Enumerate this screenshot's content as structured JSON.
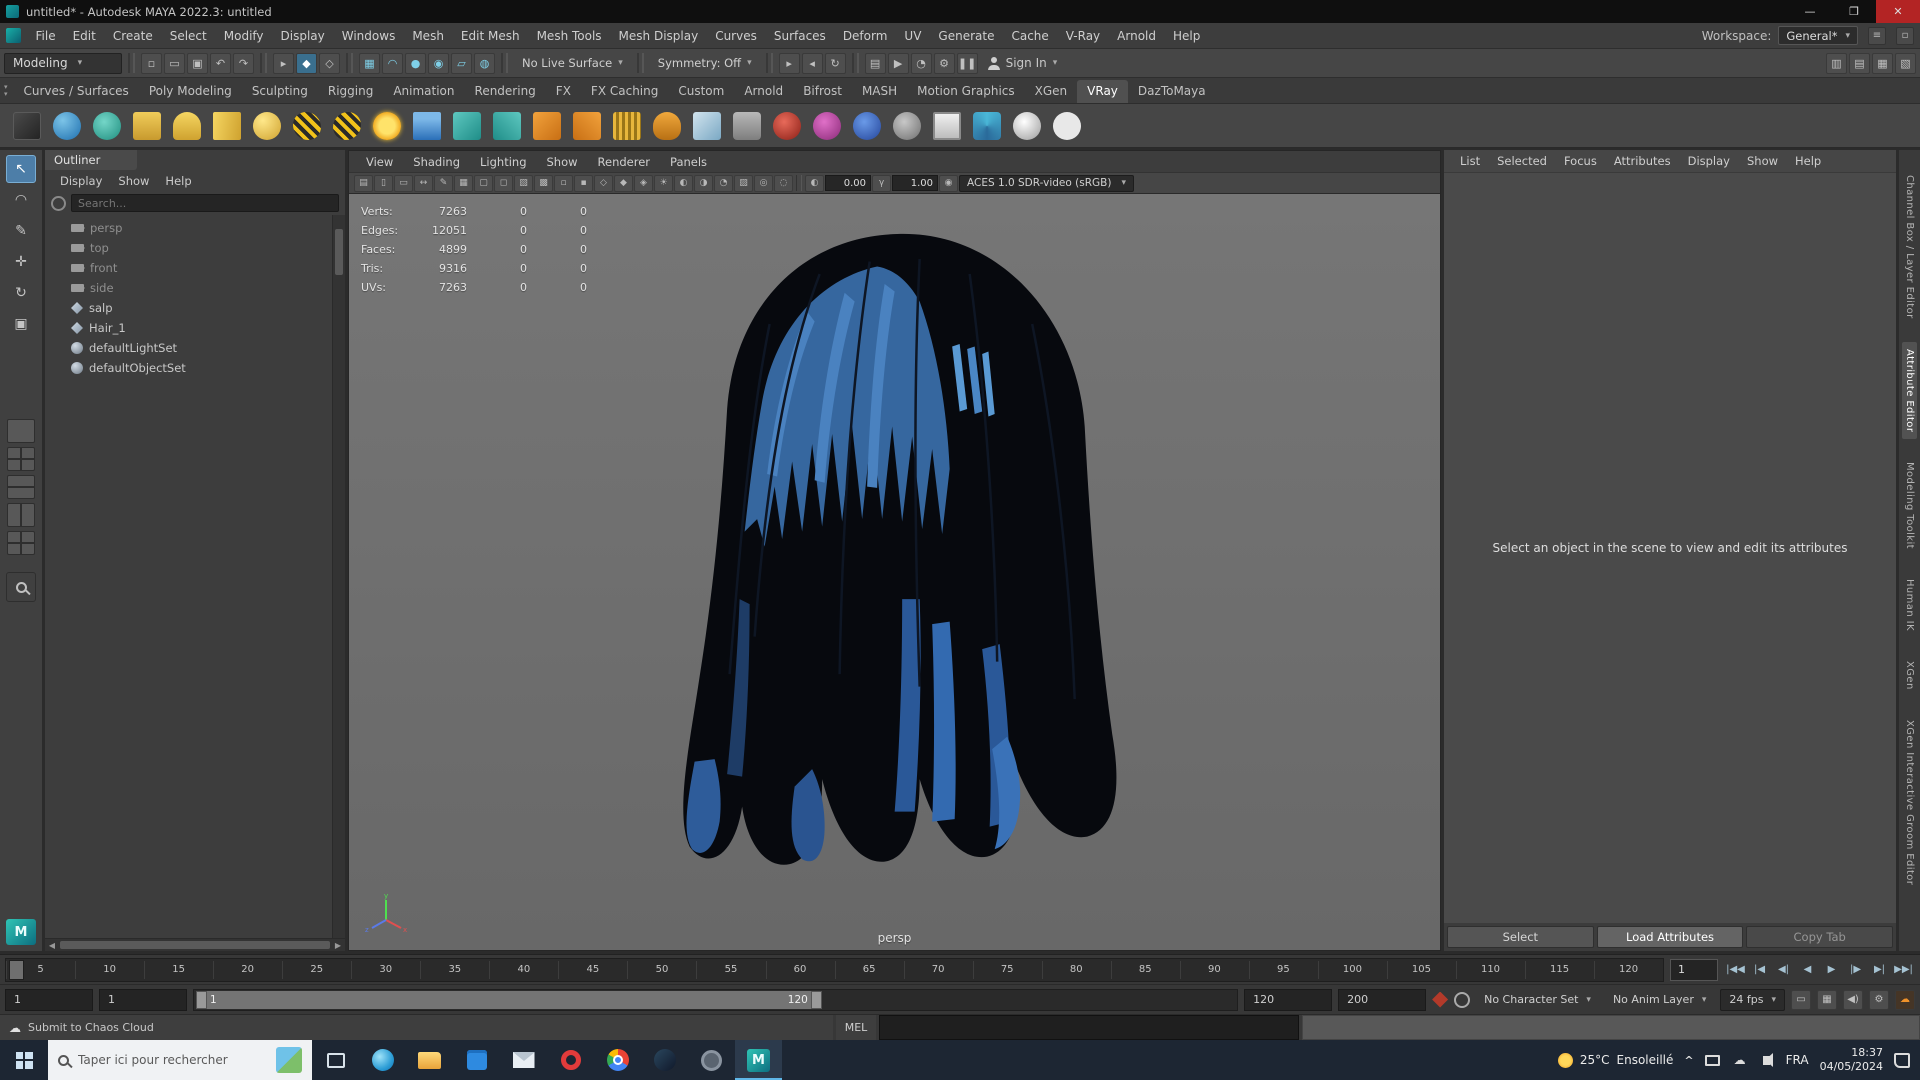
{
  "titlebar": {
    "title": "untitled* - Autodesk MAYA 2022.3: untitled",
    "minimize_glyph": "—",
    "maximize_glyph": "❐",
    "close_glyph": "✕"
  },
  "menubar": {
    "items": [
      "File",
      "Edit",
      "Create",
      "Select",
      "Modify",
      "Display",
      "Windows",
      "Mesh",
      "Edit Mesh",
      "Mesh Tools",
      "Mesh Display",
      "Curves",
      "Surfaces",
      "Deform",
      "UV",
      "Generate",
      "Cache",
      "V-Ray",
      "Arnold",
      "Help"
    ],
    "workspace_label": "Workspace:",
    "workspace_value": "General*"
  },
  "statusline": {
    "mode": "Modeling",
    "live_surface": "No Live Surface",
    "symmetry": "Symmetry: Off",
    "signin": "Sign In",
    "file_icons": [
      {
        "name": "new-scene-icon",
        "glyph": "▫"
      },
      {
        "name": "open-scene-icon",
        "glyph": "▭"
      },
      {
        "name": "save-scene-icon",
        "glyph": "▣"
      },
      {
        "name": "undo-icon",
        "glyph": "↶"
      },
      {
        "name": "redo-icon",
        "glyph": "↷"
      }
    ],
    "select_icons": [
      {
        "name": "select-hierarchy-icon",
        "glyph": "▸",
        "on": "false"
      },
      {
        "name": "select-object-icon",
        "glyph": "◆",
        "on": "true"
      },
      {
        "name": "select-component-icon",
        "glyph": "◇",
        "on": "false"
      }
    ],
    "snap_icons": [
      {
        "name": "snap-grid-icon",
        "glyph": "▦"
      },
      {
        "name": "snap-curve-icon",
        "glyph": "◠"
      },
      {
        "name": "snap-point-icon",
        "glyph": "●"
      },
      {
        "name": "snap-projected-center-icon",
        "glyph": "◉"
      },
      {
        "name": "snap-view-plane-icon",
        "glyph": "▱"
      },
      {
        "name": "make-live-icon",
        "glyph": "◍"
      }
    ],
    "history_icons": [
      {
        "name": "input-connections-icon",
        "glyph": "▸"
      },
      {
        "name": "output-connections-icon",
        "glyph": "◂"
      },
      {
        "name": "construction-history-icon",
        "glyph": "↻"
      }
    ],
    "render_icons": [
      {
        "name": "open-render-view-icon",
        "glyph": "▤"
      },
      {
        "name": "render-current-frame-icon",
        "glyph": "▶"
      },
      {
        "name": "ipr-render-icon",
        "glyph": "◔"
      },
      {
        "name": "render-settings-icon",
        "glyph": "⚙"
      },
      {
        "name": "pause-icon",
        "glyph": "❚❚"
      }
    ],
    "right_icons": [
      {
        "name": "modeling-toolkit-toggle-icon",
        "glyph": "▥"
      },
      {
        "name": "attribute-editor-toggle-icon",
        "glyph": "▤"
      },
      {
        "name": "tool-settings-toggle-icon",
        "glyph": "▦"
      },
      {
        "name": "channel-box-toggle-icon",
        "glyph": "▧"
      }
    ]
  },
  "shelf": {
    "active_tab": "VRay",
    "tabs": [
      "Curves / Surfaces",
      "Poly Modeling",
      "Sculpting",
      "Rigging",
      "Animation",
      "Rendering",
      "FX",
      "FX Caching",
      "Custom",
      "Arnold",
      "Bifrost",
      "MASH",
      "Motion Graphics",
      "XGen",
      "VRay",
      "DazToMaya"
    ],
    "icons": [
      {
        "name": "vray-render-settings-icon",
        "style": "background:linear-gradient(135deg,#4a4a4a,#242424);border:1px solid #5a5a5a;border-radius:3px"
      },
      {
        "name": "vray-frame-buffer-icon",
        "style": "background:radial-gradient(circle at 35% 30%,#7cc4e8,#1e6fae);border-radius:50%"
      },
      {
        "name": "vray-ipr-icon",
        "style": "background:radial-gradient(circle at 40% 35%,#74d6c8,#1f8d7e);border-radius:50%"
      },
      {
        "name": "vray-batch-render-icon",
        "style": "background:linear-gradient(#f0cc5a,#c89a2e);border-radius:3px"
      },
      {
        "name": "vray-dome-light-icon",
        "style": "background:linear-gradient(#f5d662,#cfa22f);border-radius:50% 50% 4px 4px"
      },
      {
        "name": "vray-rect-light-icon",
        "style": "background:linear-gradient(100deg,#f5d662,#cfa22f);border-radius:2px"
      },
      {
        "name": "vray-sphere-light-icon",
        "style": "background:radial-gradient(circle at 35% 30%,#ffe88a,#cfa22f);border-radius:50%"
      },
      {
        "name": "vray-bee-icon",
        "style": "background:repeating-linear-gradient(45deg,#f2c21a 0 4px,#2a2a2a 4px 8px);border-radius:55% 65% 55% 65%"
      },
      {
        "name": "vray-bee-2-icon",
        "style": "background:repeating-linear-gradient(45deg,#f2c21a 0 4px,#2a2a2a 4px 8px);border-radius:65% 55% 65% 55%"
      },
      {
        "name": "vray-sun-icon",
        "style": "background:radial-gradient(circle,#ffe36a 40%,#f0a81e 72%);border-radius:50%;box-shadow:0 0 5px #f0c030"
      },
      {
        "name": "vray-water-icon",
        "style": "background:linear-gradient(#7db8e8 25%,#2a6fb8);border-radius:2px"
      },
      {
        "name": "vray-proxy-export-icon",
        "style": "background:linear-gradient(135deg,#5ec8c0,#1f8d88);border-radius:3px"
      },
      {
        "name": "vray-proxy-import-icon",
        "style": "background:linear-gradient(225deg,#5ec8c0,#1f8d88);border-radius:3px"
      },
      {
        "name": "vray-scene-export-icon",
        "style": "background:linear-gradient(135deg,#f2a23c,#c86f14);border-radius:3px"
      },
      {
        "name": "vray-scene-import-icon",
        "style": "background:linear-gradient(225deg,#f2a23c,#c86f14);border-radius:3px"
      },
      {
        "name": "vray-displacement-icon",
        "style": "background:repeating-linear-gradient(90deg,#e8b63c 0 3px,#9a7518 3px 6px);border-radius:3px"
      },
      {
        "name": "vray-fur-icon",
        "style": "background:linear-gradient(#f0a83c,#b87014);border-radius:50% 50% 40% 40%"
      },
      {
        "name": "vray-clipper-icon",
        "style": "background:linear-gradient(135deg,#d2e4ee,#7aa8c4);border-radius:3px"
      },
      {
        "name": "vray-object-properties-icon",
        "style": "background:linear-gradient(#b8b8b8,#7e7e7e);border-radius:4px"
      },
      {
        "name": "vray-mesh-light-icon",
        "style": "background:radial-gradient(circle at 40% 35%,#e86a5a,#8a1f16);border-radius:50%"
      },
      {
        "name": "vray-material-icon",
        "style": "background:radial-gradient(circle at 40% 35%,#e070c8,#8a2a78);border-radius:50%"
      },
      {
        "name": "vray-blend-material-icon",
        "style": "background:radial-gradient(circle at 40% 35%,#6a9ae8,#24459a);border-radius:50%"
      },
      {
        "name": "vray-override-material-icon",
        "style": "background:radial-gradient(circle at 40% 35%,#c8c8c8,#6e6e6e);border-radius:50%"
      },
      {
        "name": "vray-vfb-window-icon",
        "style": "background:linear-gradient(#efefef,#bdbdbd);border:2px solid #8a8a8a;border-radius:2px"
      },
      {
        "name": "vray-node-editor-icon",
        "style": "background:conic-gradient(#4ab8d8,#2a6a9a,#4ab8d8);border-radius:4px"
      },
      {
        "name": "vray-light-lister-icon",
        "style": "background:radial-gradient(circle at 40% 35%,#ffffff,#9a9a9a);border-radius:50%"
      },
      {
        "name": "chaos-cloud-icon",
        "style": "background:#e8e8e8;border-radius:50%"
      }
    ]
  },
  "toolbox": {
    "tools": [
      {
        "name": "select-tool-icon",
        "glyph": "↖",
        "on": "true"
      },
      {
        "name": "lasso-tool-icon",
        "glyph": "◠",
        "on": "false"
      },
      {
        "name": "paint-select-tool-icon",
        "glyph": "✎",
        "on": "false"
      },
      {
        "name": "move-tool-icon",
        "glyph": "✛",
        "on": "false"
      },
      {
        "name": "rotate-tool-icon",
        "glyph": "↻",
        "on": "false"
      },
      {
        "name": "scale-tool-icon",
        "glyph": "▣",
        "on": "false"
      }
    ]
  },
  "outliner": {
    "title": "Outliner",
    "menus": [
      "Display",
      "Show",
      "Help"
    ],
    "search_placeholder": "Search...",
    "items": [
      {
        "label": "persp",
        "icon": "camera-icon",
        "dim": "true"
      },
      {
        "label": "top",
        "icon": "camera-icon",
        "dim": "true"
      },
      {
        "label": "front",
        "icon": "camera-icon",
        "dim": "true"
      },
      {
        "label": "side",
        "icon": "camera-icon",
        "dim": "true"
      },
      {
        "label": "salp",
        "icon": "mesh-icon",
        "dim": "false"
      },
      {
        "label": "Hair_1",
        "icon": "mesh-icon",
        "dim": "false"
      },
      {
        "label": "defaultLightSet",
        "icon": "set-icon",
        "dim": "false"
      },
      {
        "label": "defaultObjectSet",
        "icon": "set-icon",
        "dim": "false"
      }
    ]
  },
  "viewport": {
    "menus": [
      "View",
      "Shading",
      "Lighting",
      "Show",
      "Renderer",
      "Panels"
    ],
    "toolbar_icons": [
      {
        "name": "camera-attributes-icon",
        "glyph": "▤"
      },
      {
        "name": "bookmark-icon",
        "glyph": "▯"
      },
      {
        "name": "image-plane-icon",
        "glyph": "▭"
      },
      {
        "name": "2d-pan-zoom-icon",
        "glyph": "↔"
      },
      {
        "name": "grease-pencil-icon",
        "glyph": "✎"
      },
      {
        "name": "grid-icon",
        "glyph": "▦"
      },
      {
        "name": "film-gate-icon",
        "glyph": "▢"
      },
      {
        "name": "resolution-gate-icon",
        "glyph": "◻"
      },
      {
        "name": "gate-mask-icon",
        "glyph": "▧"
      },
      {
        "name": "field-chart-icon",
        "glyph": "▩"
      },
      {
        "name": "safe-action-icon",
        "glyph": "▫"
      },
      {
        "name": "safe-title-icon",
        "glyph": "▪"
      },
      {
        "name": "wireframe-icon",
        "glyph": "◇"
      },
      {
        "name": "shaded-icon",
        "glyph": "◆"
      },
      {
        "name": "textured-icon",
        "glyph": "◈"
      },
      {
        "name": "use-all-lights-icon",
        "glyph": "☀"
      },
      {
        "name": "shadows-icon",
        "glyph": "◐"
      },
      {
        "name": "ambient-occlusion-icon",
        "glyph": "◑"
      },
      {
        "name": "motion-blur-icon",
        "glyph": "◔"
      },
      {
        "name": "multisample-aa-icon",
        "glyph": "▨"
      },
      {
        "name": "isolate-select-icon",
        "glyph": "◎"
      },
      {
        "name": "xray-icon",
        "glyph": "◌"
      }
    ],
    "exposure_value": "0.00",
    "gamma_value": "1.00",
    "colorspace": "ACES 1.0 SDR-video (sRGB)",
    "hud": [
      {
        "label": "Verts:",
        "value": "7263",
        "col1": "0",
        "col2": "0"
      },
      {
        "label": "Edges:",
        "value": "12051",
        "col1": "0",
        "col2": "0"
      },
      {
        "label": "Faces:",
        "value": "4899",
        "col1": "0",
        "col2": "0"
      },
      {
        "label": "Tris:",
        "value": "9316",
        "col1": "0",
        "col2": "0"
      },
      {
        "label": "UVs:",
        "value": "7263",
        "col1": "0",
        "col2": "0"
      }
    ],
    "camera_label": "persp"
  },
  "attribute_editor": {
    "menus": [
      "List",
      "Selected",
      "Focus",
      "Attributes",
      "Display",
      "Show",
      "Help"
    ],
    "message": "Select an object in the scene to view and edit its attributes",
    "buttons": [
      {
        "label": "Select",
        "state": "normal"
      },
      {
        "label": "Load Attributes",
        "state": "primary"
      },
      {
        "label": "Copy Tab",
        "state": "dim"
      }
    ]
  },
  "right_sidebar": {
    "tabs": [
      {
        "label": "Channel Box / Layer Editor",
        "active": "false"
      },
      {
        "label": "Attribute Editor",
        "active": "true"
      },
      {
        "label": "Modeling Toolkit",
        "active": "false"
      },
      {
        "label": "Human IK",
        "active": "false"
      },
      {
        "label": "XGen",
        "active": "false"
      },
      {
        "label": "XGen Interactive Groom Editor",
        "active": "false"
      }
    ]
  },
  "timeline": {
    "ticks": [
      "5",
      "10",
      "15",
      "20",
      "25",
      "30",
      "35",
      "40",
      "45",
      "50",
      "55",
      "60",
      "65",
      "70",
      "75",
      "80",
      "85",
      "90",
      "95",
      "100",
      "105",
      "110",
      "115",
      "120"
    ],
    "current_frame": "1",
    "playback_buttons": [
      {
        "name": "go-to-start-button",
        "glyph": "|◀◀"
      },
      {
        "name": "step-back-frame-button",
        "glyph": "|◀"
      },
      {
        "name": "step-back-key-button",
        "glyph": "◀|"
      },
      {
        "name": "play-backwards-button",
        "glyph": "◀"
      },
      {
        "name": "play-forwards-button",
        "glyph": "▶"
      },
      {
        "name": "step-forward-key-button",
        "glyph": "|▶"
      },
      {
        "name": "step-forward-frame-button",
        "glyph": "▶|"
      },
      {
        "name": "go-to-end-button",
        "glyph": "▶▶|"
      }
    ]
  },
  "range_slider": {
    "anim_start": "1",
    "playback_start": "1",
    "bar_start_label": "1",
    "bar_end_label": "120",
    "playback_end": "120",
    "anim_end": "200",
    "character_set": "No Character Set",
    "anim_layer": "No Anim Layer",
    "fps": "24 fps"
  },
  "command_line": {
    "help_text": "Submit to Chaos Cloud",
    "mel_label": "MEL"
  },
  "taskbar": {
    "search_placeholder": "Taper ici pour rechercher",
    "apps": [
      {
        "name": "task-view-icon",
        "glyph": "",
        "active": "false"
      },
      {
        "name": "edge-icon",
        "glyph": "",
        "active": "false"
      },
      {
        "name": "file-explorer-icon",
        "glyph": "",
        "active": "false"
      },
      {
        "name": "microsoft-store-icon",
        "glyph": "",
        "active": "false"
      },
      {
        "name": "mail-app-icon",
        "glyph": "",
        "active": "false"
      },
      {
        "name": "opera-icon",
        "glyph": "",
        "active": "false"
      },
      {
        "name": "chrome-icon",
        "glyph": "",
        "active": "false"
      },
      {
        "name": "steam-icon",
        "glyph": "",
        "active": "false"
      },
      {
        "name": "camera-app-icon",
        "glyph": "",
        "active": "false"
      },
      {
        "name": "maya-taskbar-icon",
        "glyph": "M",
        "active": "true"
      }
    ],
    "weather_temp": "25°C",
    "weather_desc": "Ensoleillé",
    "language": "FRA",
    "time": "18:37",
    "date": "04/05/2024"
  }
}
